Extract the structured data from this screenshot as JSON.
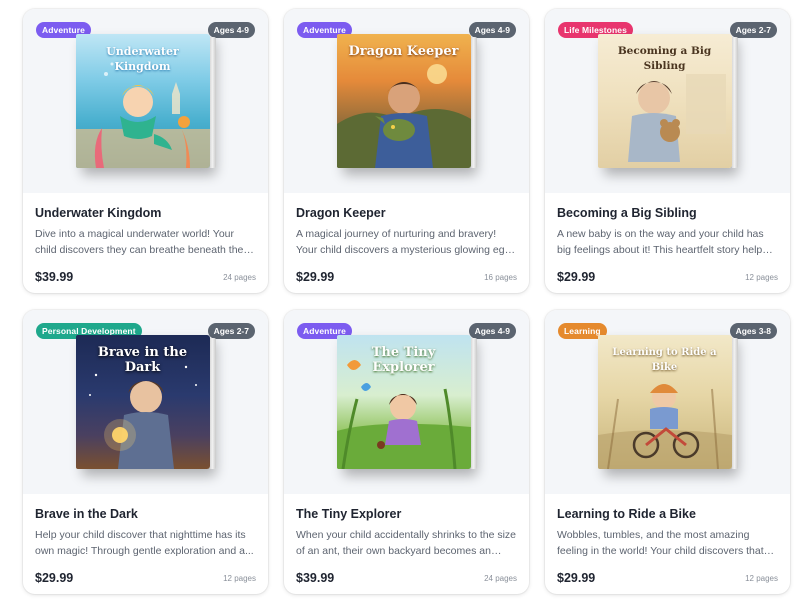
{
  "books": [
    {
      "category": "Adventure",
      "category_color": "#7c5cf0",
      "age": "Ages 4-9",
      "cover_title": "Underwater Kingdom",
      "cover_theme": "underwater",
      "title": "Underwater Kingdom",
      "description": "Dive into a magical underwater world! Your child discovers they can breathe beneath the waves,...",
      "price": "$39.99",
      "pages": "24 pages"
    },
    {
      "category": "Adventure",
      "category_color": "#7c5cf0",
      "age": "Ages 4-9",
      "cover_title": "Dragon Keeper",
      "cover_theme": "dragon",
      "title": "Dragon Keeper",
      "description": "A magical journey of nurturing and bravery! Your child discovers a mysterious glowing egg in the...",
      "price": "$29.99",
      "pages": "16 pages"
    },
    {
      "category": "Life Milestones",
      "category_color": "#e8356e",
      "age": "Ages 2-7",
      "cover_title": "Becoming a Big Sibling",
      "cover_theme": "sibling",
      "title": "Becoming a Big Sibling",
      "description": "A new baby is on the way and your child has big feelings about it! This heartfelt story helps the...",
      "price": "$29.99",
      "pages": "12 pages"
    },
    {
      "category": "Personal Development",
      "category_color": "#1fa88c",
      "age": "Ages 2-7",
      "cover_title": "Brave in the Dark",
      "cover_theme": "dark",
      "title": "Brave in the Dark",
      "description": "Help your child discover that nighttime has its own magic! Through gentle exploration and a...",
      "price": "$29.99",
      "pages": "12 pages"
    },
    {
      "category": "Adventure",
      "category_color": "#7c5cf0",
      "age": "Ages 4-9",
      "cover_title": "The Tiny Explorer",
      "cover_theme": "explorer",
      "title": "The Tiny Explorer",
      "description": "When your child accidentally shrinks to the size of an ant, their own backyard becomes an epic...",
      "price": "$39.99",
      "pages": "24 pages"
    },
    {
      "category": "Learning",
      "category_color": "#e58a2e",
      "age": "Ages 3-8",
      "cover_title": "Learning to Ride a Bike",
      "cover_theme": "bike",
      "title": "Learning to Ride a Bike",
      "description": "Wobbles, tumbles, and the most amazing feeling in the world! Your child discovers that falling...",
      "price": "$29.99",
      "pages": "12 pages"
    }
  ]
}
